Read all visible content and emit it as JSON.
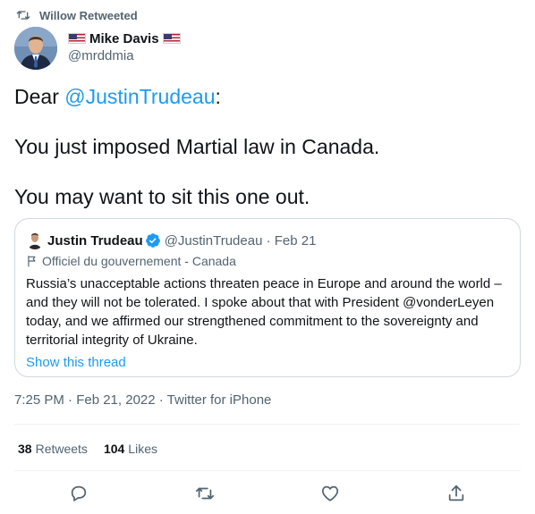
{
  "retweet": {
    "label": "Willow Retweeted"
  },
  "tweet": {
    "author_name": "Mike Davis",
    "author_handle": "@mrddmia",
    "text_prefix": "Dear ",
    "mention": "@JustinTrudeau",
    "text_suffix": ":",
    "line2": "You just imposed Martial law in Canada.",
    "line3": "You may want to sit this one out.",
    "timestamp": "7:25 PM · Feb 21, 2022 · Twitter for iPhone",
    "stats": {
      "retweets_count": "38",
      "retweets_label": "Retweets",
      "likes_count": "104",
      "likes_label": "Likes"
    }
  },
  "quote": {
    "author_name": "Justin Trudeau",
    "meta": "@JustinTrudeau · Feb 21",
    "label": "Officiel du gouvernement - Canada",
    "body": "Russia’s unacceptable actions threaten peace in Europe and around the world – and they will not be tolerated. I spoke about that with President @vonderLeyen today, and we affirmed our strengthened commitment to the sovereignty and territorial integrity of Ukraine.",
    "thread_link": "Show this thread"
  },
  "colors": {
    "accent": "#1d9bf0",
    "muted": "#536471",
    "text": "#0f1419",
    "border": "#cfd9de"
  },
  "icons": [
    "retweet-icon",
    "us-flag-icon",
    "verified-badge-icon",
    "government-flag-icon",
    "reply-icon",
    "like-icon",
    "share-icon"
  ]
}
